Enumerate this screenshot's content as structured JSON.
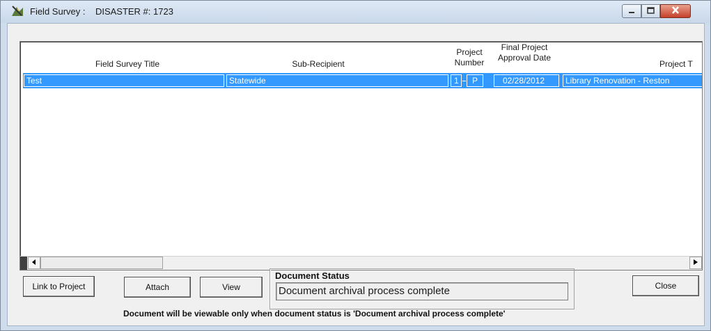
{
  "window": {
    "title_prefix": "Field Survey :",
    "disaster_label": "DISASTER #: 1723"
  },
  "grid": {
    "headers": {
      "title": "Field Survey Title",
      "sub_recipient": "Sub-Recipient",
      "project_number_1": "Project",
      "project_number_2": "Number",
      "approval_1": "Final Project",
      "approval_2": "Approval Date",
      "project_title": "Project T"
    },
    "rows": [
      {
        "title": "Test",
        "sub_recipient": "Statewide",
        "project_num": "1",
        "project_suffix": "P",
        "approval_date": "02/28/2012",
        "project_title": "Library Renovation - Reston"
      }
    ]
  },
  "buttons": {
    "link": "Link to Project",
    "attach": "Attach",
    "view": "View",
    "close": "Close"
  },
  "document_status": {
    "label": "Document Status",
    "value": "Document archival process complete"
  },
  "note": "Document will be viewable only when document status is 'Document archival process complete'",
  "colors": {
    "selection": "#3399ff",
    "close_button": "#c5402a"
  },
  "icons": {
    "app": "field-survey-app-icon",
    "minimize": "minimize-icon",
    "maximize": "maximize-icon",
    "close": "close-icon"
  }
}
